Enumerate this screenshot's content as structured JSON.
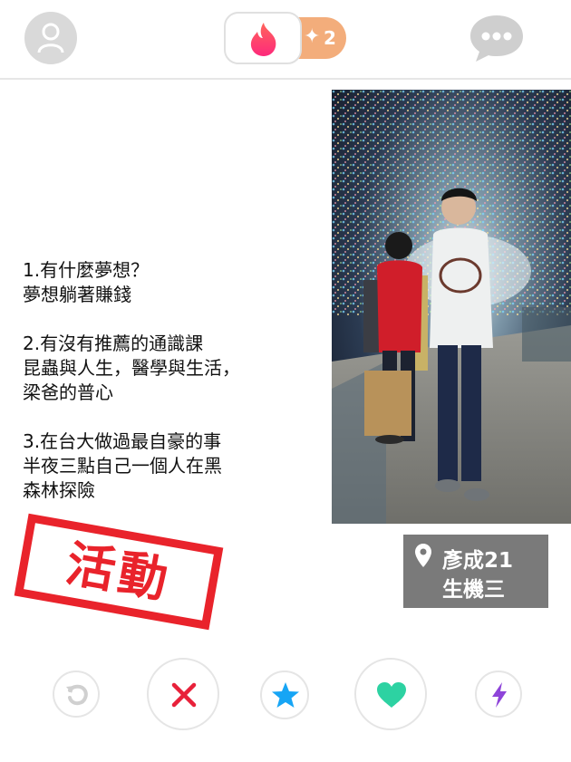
{
  "header": {
    "profile_icon": "person-icon",
    "brand_icon": "flame-icon",
    "super_like": {
      "icon": "sparkle-icon",
      "symbol": "✦",
      "count": "2"
    },
    "chat_icon": "chat-bubble-icon"
  },
  "card": {
    "bio": [
      {
        "q": "1.有什麼夢想？",
        "a": [
          "夢想躺著賺錢"
        ]
      },
      {
        "q": "2.有沒有推薦的通識課",
        "a": [
          "昆蟲與人生，醫學與生活，",
          "梁爸的普心"
        ]
      },
      {
        "q": "3.在台大做過最自豪的事",
        "a": [
          "半夜三點自己一個人在黑",
          "森林探險"
        ]
      }
    ],
    "location": {
      "icon": "location-pin-icon",
      "name": "彥成21",
      "department": "生機三"
    },
    "stamp": "活動"
  },
  "actions": [
    "rewind",
    "nope",
    "super-like",
    "like",
    "boost"
  ],
  "colors": {
    "brand": "#fe3c72",
    "nope": "#e8213a",
    "super_like": "#17a5f5",
    "like": "#2dd2a2",
    "boost": "#8e44d9",
    "rewind": "#d0d0d0",
    "stamp": "#e9232b",
    "super_pill": "#f3ad7b"
  }
}
